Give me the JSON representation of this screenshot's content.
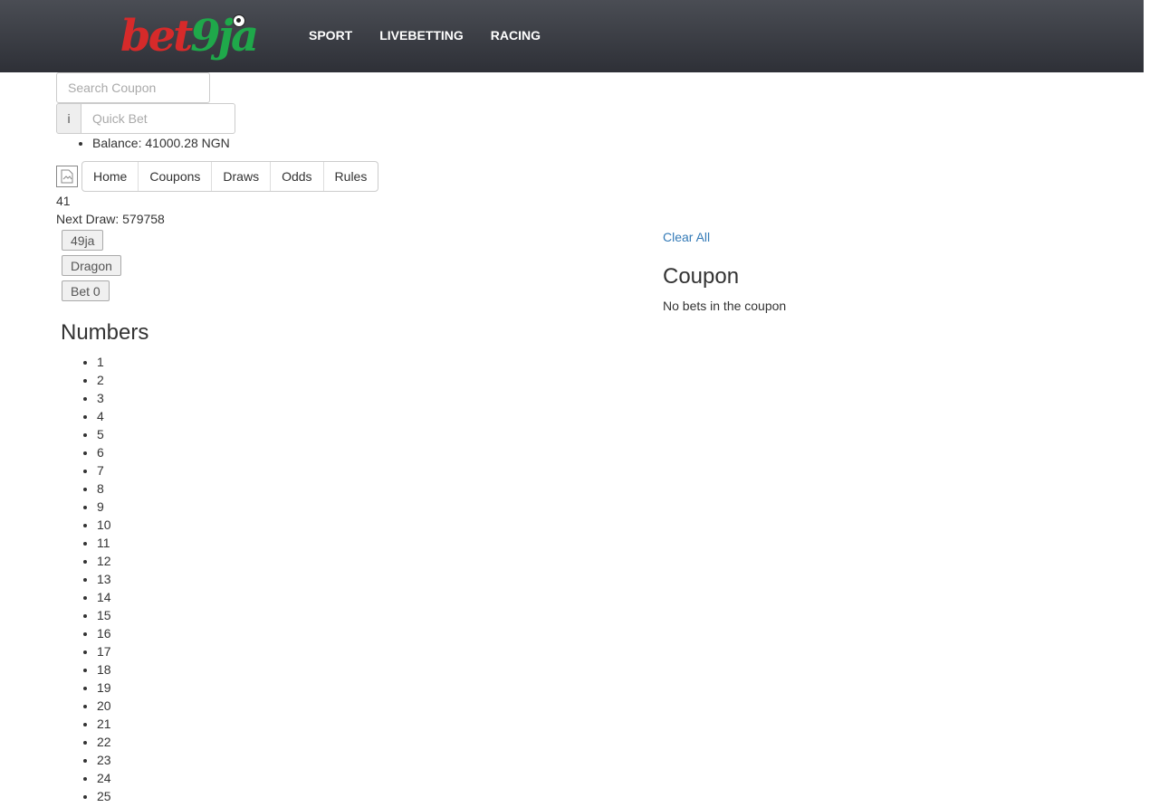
{
  "header": {
    "logo": {
      "part1": "bet",
      "part2": "9ja"
    },
    "nav": [
      {
        "label": "SPORT"
      },
      {
        "label": "LIVEBETTING"
      },
      {
        "label": "RACING"
      }
    ]
  },
  "search": {
    "placeholder": "Search Coupon"
  },
  "quickbet": {
    "addon": "i",
    "placeholder": "Quick Bet"
  },
  "balance": {
    "text": "Balance: 41000.28 NGN"
  },
  "image_icon": "broken-image-icon",
  "subnav": [
    {
      "label": "Home"
    },
    {
      "label": "Coupons"
    },
    {
      "label": "Draws"
    },
    {
      "label": "Odds"
    },
    {
      "label": "Rules"
    }
  ],
  "countdown": "41",
  "next_draw": "Next Draw: 579758",
  "games": [
    {
      "label": "49ja"
    },
    {
      "label": "Dragon"
    },
    {
      "label": "Bet 0"
    }
  ],
  "numbers": {
    "title": "Numbers",
    "items": [
      "1",
      "2",
      "3",
      "4",
      "5",
      "6",
      "7",
      "8",
      "9",
      "10",
      "11",
      "12",
      "13",
      "14",
      "15",
      "16",
      "17",
      "18",
      "19",
      "20",
      "21",
      "22",
      "23",
      "24",
      "25"
    ]
  },
  "coupon": {
    "clear_all": "Clear All",
    "title": "Coupon",
    "empty_text": "No bets in the coupon"
  },
  "colors": {
    "logo_red": "#d62a2a",
    "logo_green": "#1fa84a",
    "link": "#337ab7",
    "topbar": "#3a3d44"
  }
}
